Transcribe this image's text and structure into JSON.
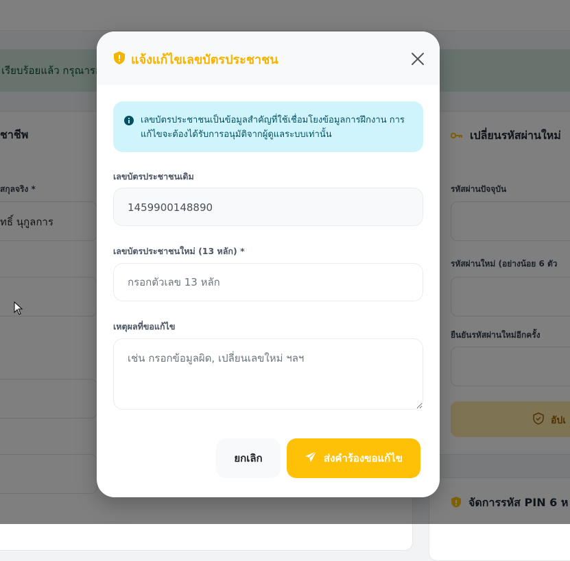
{
  "background": {
    "alert_text": "เรียบร้อยแล้ว กรุณารอการอนุมัติ",
    "left_card": {
      "title": "ชาชีพ",
      "field_label": "สกุลจริง *",
      "field_value": "ทธิ์ นุกูลการ"
    },
    "right_card": {
      "title": "เปลี่ยนรหัสผ่านใหม่",
      "current_password_label": "รหัสผ่านปัจจุบัน",
      "new_password_label": "รหัสผ่านใหม่ (อย่างน้อย 6 ตัว",
      "confirm_password_label": "ยืนยันรหัสผ่านใหม่อีกครั้ง",
      "update_button_label": "อัปเ"
    },
    "pin_card": {
      "title": "จัดการรหัส PIN 6 ห"
    }
  },
  "modal": {
    "title": "แจ้งแก้ไขเลขบัตรประชาชน",
    "info_text": "เลขบัตรประชาชนเป็นข้อมูลสำคัญที่ใช้เชื่อมโยงข้อมูลการฝึกงาน การแก้ไขจะต้องได้รับการอนุมัติจากผู้ดูแลระบบเท่านั้น",
    "old_id_label": "เลขบัตรประชาชนเดิม",
    "old_id_value": "1459900148890",
    "new_id_label": "เลขบัตรประชาชนใหม่ (13 หลัก) *",
    "new_id_placeholder": "กรอกตัวเลข 13 หลัก",
    "reason_label": "เหตุผลที่ขอแก้ไข",
    "reason_placeholder": "เช่น กรอกข้อมูลผิด, เปลี่ยนเลขใหม่ ฯลฯ",
    "cancel_label": "ยกเลิก",
    "submit_label": "ส่งคำร้องขอแก้ไข"
  },
  "colors": {
    "accent": "#ffc107",
    "title": "#f5b400",
    "info_bg": "#cff4fc",
    "overlay": "rgba(0,0,0,0.5)"
  },
  "icons": {
    "title_icon": "shield-icon",
    "close_icon": "close-icon",
    "info_icon": "info-icon",
    "submit_icon": "send-icon",
    "key_icon": "key-icon"
  }
}
